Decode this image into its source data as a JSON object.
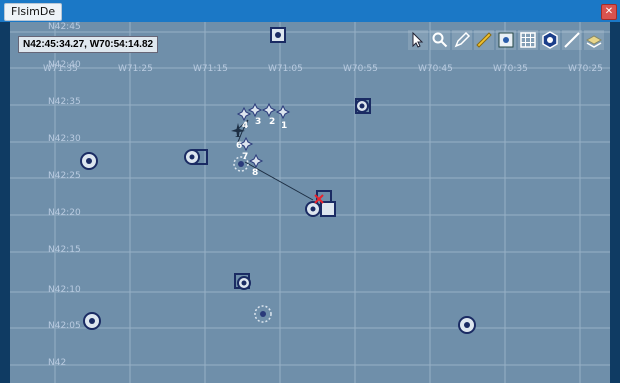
{
  "window": {
    "title": "FlsimDe",
    "close_label": "✕"
  },
  "map": {
    "coord_readout": "N42:45:34.27, W70:54:14.82",
    "lat_labels": [
      "N42:45",
      "N42:40",
      "N42:35",
      "N42:30",
      "N42:25",
      "N42:20",
      "N42:15",
      "N42:10",
      "N42:05",
      "N42"
    ],
    "lon_labels": [
      "W71:35",
      "W71:25",
      "W71:15",
      "W71:05",
      "W70:55",
      "W70:45",
      "W70:35",
      "W70:25"
    ],
    "waypoint_labels": [
      "4",
      "3",
      "2",
      "1",
      "6",
      "7",
      "8"
    ]
  },
  "toolbar": {
    "tools": [
      "select-arrow-icon",
      "zoom-icon",
      "pencil-icon",
      "ruler-icon",
      "center-icon",
      "grid-icon",
      "hexagon-icon",
      "line-icon",
      "layers-icon"
    ]
  },
  "colors": {
    "map_background": "#6f8faa",
    "grid": "#a9bfd3",
    "title_bar": "#1b78c6"
  }
}
